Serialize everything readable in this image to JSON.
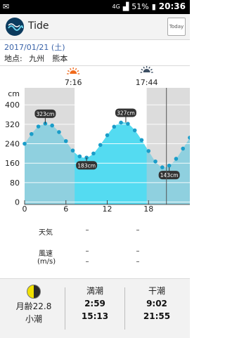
{
  "status_bar": {
    "network": "4G",
    "battery": "51%",
    "time": "20:36"
  },
  "app": {
    "title": "Tide",
    "today_label": "Today"
  },
  "header": {
    "date": "2017/01/21 (土)",
    "location_label": "地点:",
    "location_value": "九州　熊本"
  },
  "sun": {
    "sunrise": "7:16",
    "sunset": "17:44"
  },
  "chart_data": {
    "type": "area",
    "ylabel": "cm",
    "ylim": [
      -10,
      470
    ],
    "xlim": [
      0,
      24
    ],
    "y_ticks": [
      0,
      80,
      160,
      240,
      320,
      400
    ],
    "x_ticks": [
      0,
      6,
      12,
      18
    ],
    "x": [
      0,
      1,
      2,
      3,
      4,
      5,
      6,
      7,
      8,
      9,
      10,
      11,
      12,
      13,
      14,
      15,
      16,
      17,
      18,
      19,
      20,
      21,
      22,
      23,
      24
    ],
    "values": [
      240,
      280,
      311,
      323,
      315,
      288,
      251,
      212,
      188,
      183,
      200,
      235,
      275,
      310,
      327,
      322,
      295,
      255,
      210,
      167,
      143,
      150,
      178,
      220,
      265
    ],
    "annotations": [
      {
        "x": 3,
        "y": 323,
        "label": "323cm"
      },
      {
        "x": 9,
        "y": 183,
        "label": "183cm"
      },
      {
        "x": 14.7,
        "y": 327,
        "label": "327cm"
      },
      {
        "x": 21,
        "y": 143,
        "label": "143cm"
      }
    ],
    "day_start": 7.27,
    "day_end": 17.73,
    "current_time": 20.6,
    "colors": {
      "night": "#dcdcdc",
      "day": "#ffffff",
      "area_night": "#8fd0df",
      "area_day": "#54dbf1",
      "point": "#1a9dc9",
      "label_bg": "#333333"
    }
  },
  "weather": {
    "weather_label": "天気",
    "wind_label": "風速",
    "wind_unit": "(m/s)",
    "weather_val1": "–",
    "weather_val2": "–",
    "wind_val1": "–",
    "wind_val2": "–",
    "wind_val3": "–",
    "wind_val4": "–"
  },
  "footer": {
    "moon_age": "月齢22.8",
    "tide_name": "小潮",
    "high_label": "満潮",
    "high_times": [
      "2:59",
      "15:13"
    ],
    "low_label": "干潮",
    "low_times": [
      "9:02",
      "21:55"
    ]
  }
}
